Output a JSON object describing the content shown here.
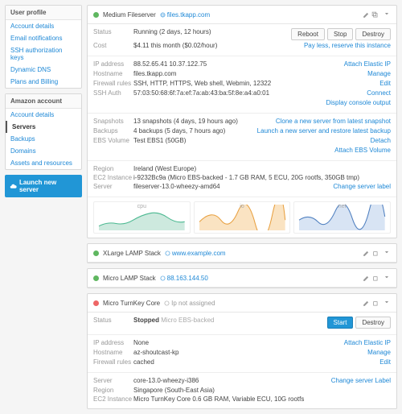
{
  "sidebar": {
    "sections": [
      {
        "title": "User profile",
        "items": [
          "Account details",
          "Email notifications",
          "SSH authorization keys",
          "Dynamic DNS",
          "Plans and Billing"
        ]
      },
      {
        "title": "Amazon account",
        "items": [
          "Account details",
          "Servers",
          "Backups",
          "Domains",
          "Assets and resources"
        ],
        "activeIndex": 1
      }
    ],
    "launch": "Launch new server"
  },
  "server1": {
    "name": "Medium Fileserver",
    "url": "files.tkapp.com",
    "statusLabel": "Status",
    "status": "Running (2 days, 12 hours)",
    "costLabel": "Cost",
    "cost": "$4.11 this month ($0.02/hour)",
    "btnReboot": "Reboot",
    "btnStop": "Stop",
    "btnDestroy": "Destroy",
    "note": "Pay less, reserve this instance",
    "ipLabel": "IP address",
    "ip": "88.52.65.41  10.37.122.75",
    "hostLabel": "Hostname",
    "host": "files.tkapp.com",
    "fwLabel": "Firewall rules",
    "fw": "SSH, HTTP, HTTPS, Web shell, Webmin, 12322",
    "sshLabel": "SSH Auth",
    "ssh": "57:03:50:68:6f:7a:ef:7a:ab:43:ba:5f:8e:a4:a0:01",
    "linkEIP": "Attach Elastic IP",
    "linkManage": "Manage",
    "linkEdit": "Edit",
    "linkConnect": "Connect",
    "linkConsole": "Display console output",
    "snapLabel": "Snapshots",
    "snap": "13 snapshots (4 days, 19 hours ago)",
    "bkLabel": "Backups",
    "bk": "4 backups (5 days, 7 hours ago)",
    "ebsLabel": "EBS Volume",
    "ebs": "Test EBS1 (50GB)",
    "linkClone": "Clone a new server from latest snapshot",
    "linkRestore": "Launch a new server and restore latest backup",
    "linkDetach": "Detach",
    "linkAttachEBS": "Attach EBS Volume",
    "regionLabel": "Region",
    "region": "Ireland (West Europe)",
    "ec2Label": "EC2 Instance",
    "ec2": "i-9232Bc9a (Micro EBS-backed - 1.7 GB RAM, 5 ECU, 20G rootfs, 350GB tmp)",
    "srvLabel": "Server",
    "srv": "fileserver-13.0-wheezy-amd64",
    "linkChange": "Change server label",
    "chartCpu": "cpu",
    "chartIo": "io",
    "chartNet": "net"
  },
  "server2": {
    "name": "XLarge LAMP Stack",
    "url": "www.example.com"
  },
  "server3": {
    "name": "Micro LAMP Stack",
    "url": "88.163.144.50"
  },
  "server4": {
    "name": "Micro TurnKey Core",
    "ipNote": "Ip not assigned",
    "statusLabel": "Status",
    "status": "Stopped",
    "statusExtra": "Micro EBS-backed",
    "btnStart": "Start",
    "btnDestroy": "Destroy",
    "ipLabel": "IP address",
    "ip": "None",
    "linkEIP": "Attach Elastic IP",
    "hostLabel": "Hostname",
    "host": "az-shoutcast-kp",
    "linkManage": "Manage",
    "fwLabel": "Firewall rules",
    "fw": "cached",
    "linkEdit": "Edit",
    "srvLabel": "Server",
    "srv": "core-13.0-wheezy-i386",
    "linkChange": "Change server Label",
    "regionLabel": "Region",
    "region": "Singapore (South-East Asia)",
    "ec2Label": "EC2 Instance",
    "ec2": "Micro TurnKey Core 0.6 GB RAM, Variable ECU, 10G rootfs"
  }
}
